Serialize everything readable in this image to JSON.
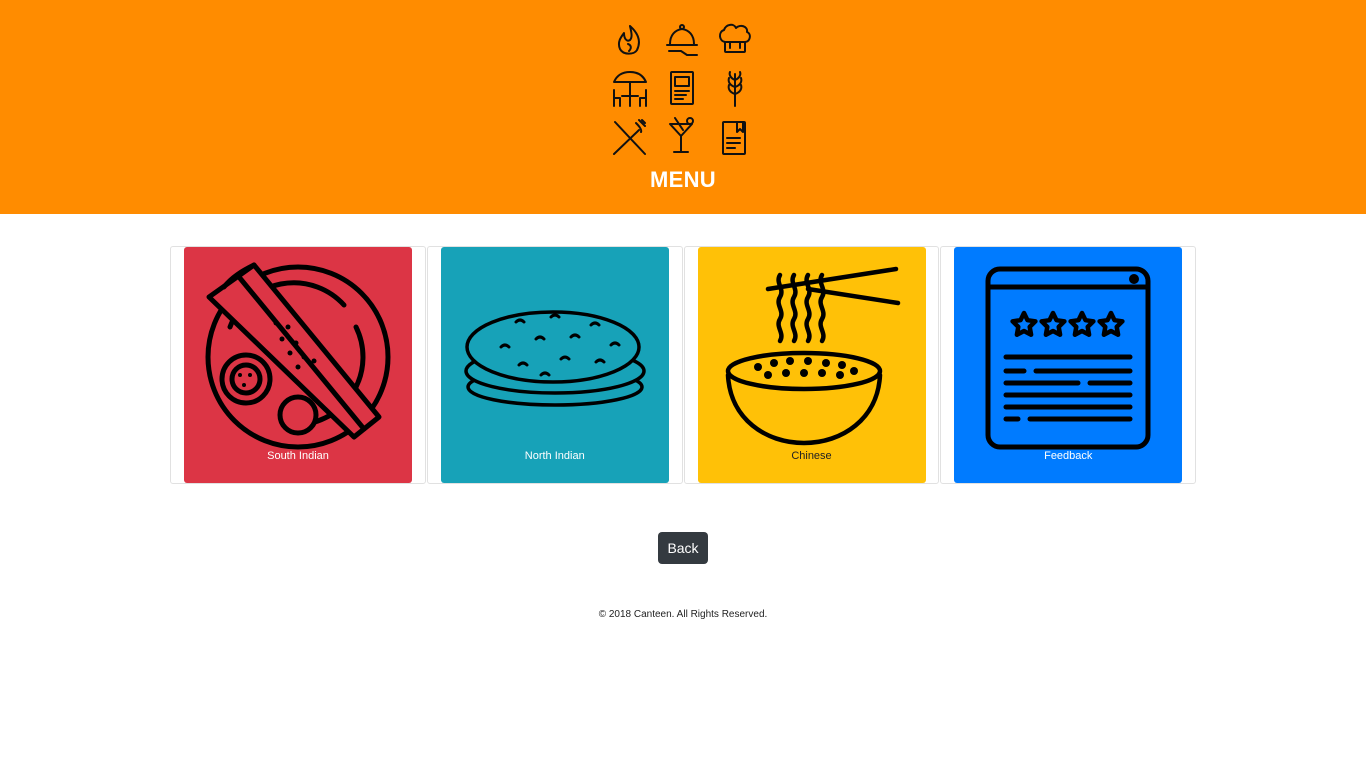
{
  "header": {
    "title": "MENU",
    "background": "#ff8c00",
    "logo_icons": [
      "flame-icon",
      "serving-cloche-icon",
      "chef-hat-icon",
      "outdoor-table-icon",
      "menu-card-icon",
      "wheat-icon",
      "fork-knife-icon",
      "cocktail-icon",
      "recipe-book-icon"
    ]
  },
  "cards": [
    {
      "label": "South Indian",
      "color": "#dc3545",
      "icon": "dosa-plate-icon"
    },
    {
      "label": "North Indian",
      "color": "#17a2b8",
      "icon": "roti-stack-icon"
    },
    {
      "label": "Chinese",
      "color": "#ffc107",
      "icon": "noodle-bowl-icon"
    },
    {
      "label": "Feedback",
      "color": "#007bff",
      "icon": "feedback-rating-icon"
    }
  ],
  "back_button": {
    "label": "Back",
    "color": "#343a40"
  },
  "footer": {
    "text": "© 2018 Canteen. All Rights Reserved."
  }
}
